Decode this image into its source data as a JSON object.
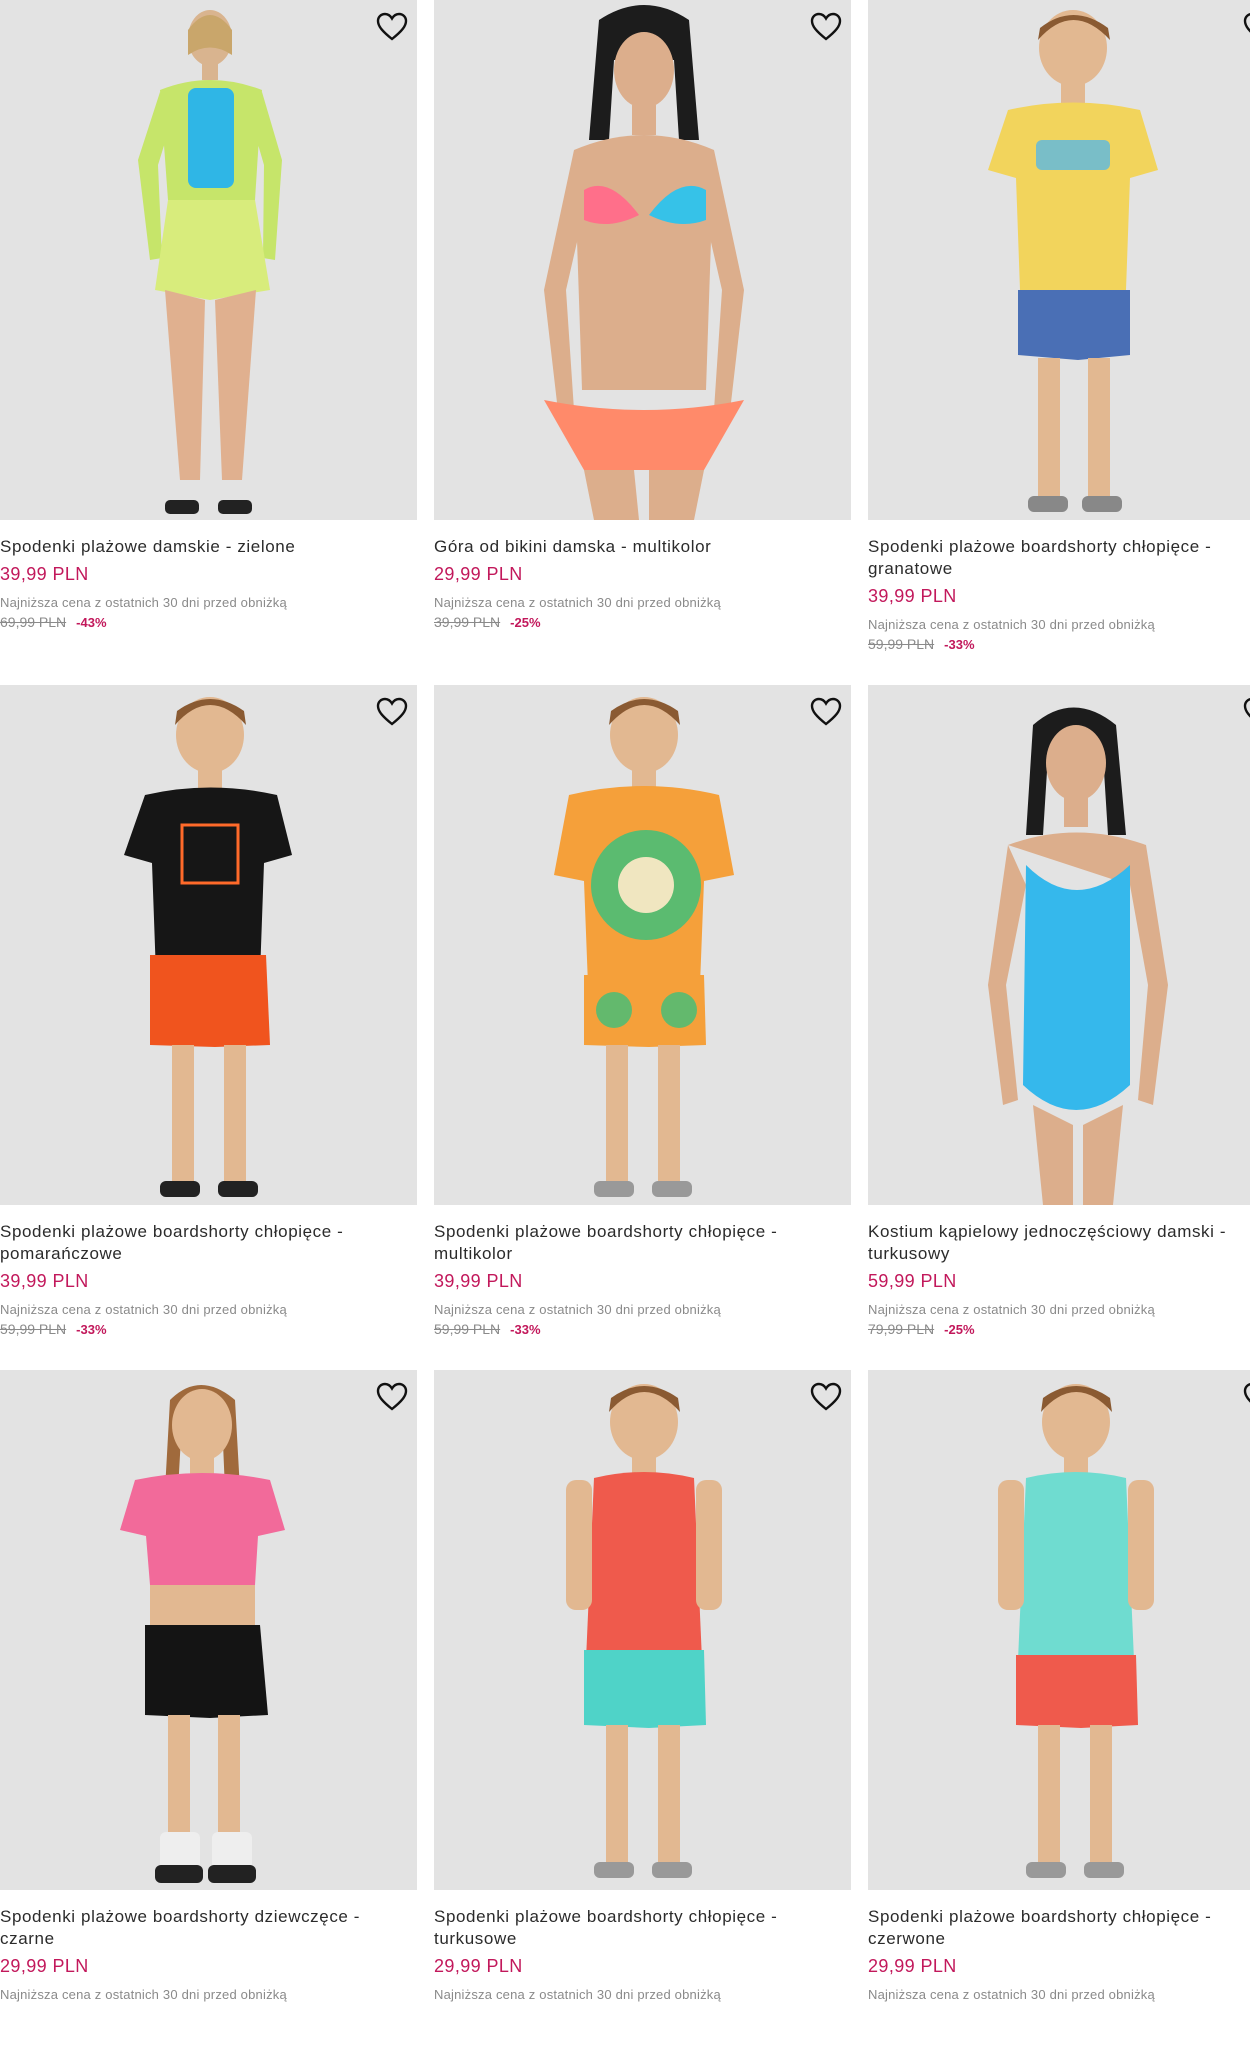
{
  "colors": {
    "price": "#c2185b",
    "muted": "#8a8a8a",
    "image_bg": "#e3e3e3"
  },
  "icons": {
    "wishlist": "heart-outline-icon"
  },
  "products": [
    {
      "name": "Spodenki plażowe damskie - zielone",
      "price": "39,99 PLN",
      "lowest_label": "Najniższa cena z ostatnich 30 dni przed obniżką",
      "old_price": "69,99 PLN",
      "discount": "-43%"
    },
    {
      "name": "Góra od bikini damska - multikolor",
      "price": "29,99 PLN",
      "lowest_label": "Najniższa cena z ostatnich 30 dni przed obniżką",
      "old_price": "39,99 PLN",
      "discount": "-25%"
    },
    {
      "name": "Spodenki plażowe boardshorty chłopięce - granatowe",
      "price": "39,99 PLN",
      "lowest_label": "Najniższa cena z ostatnich 30 dni przed obniżką",
      "old_price": "59,99 PLN",
      "discount": "-33%"
    },
    {
      "name": "Spodenki plażowe boardshorty chłopięce - pomarańczowe",
      "price": "39,99 PLN",
      "lowest_label": "Najniższa cena z ostatnich 30 dni przed obniżką",
      "old_price": "59,99 PLN",
      "discount": "-33%"
    },
    {
      "name": "Spodenki plażowe boardshorty chłopięce - multikolor",
      "price": "39,99 PLN",
      "lowest_label": "Najniższa cena z ostatnich 30 dni przed obniżką",
      "old_price": "59,99 PLN",
      "discount": "-33%"
    },
    {
      "name": "Kostium kąpielowy jednoczęściowy damski - turkusowy",
      "price": "59,99 PLN",
      "lowest_label": "Najniższa cena z ostatnich 30 dni przed obniżką",
      "old_price": "79,99 PLN",
      "discount": "-25%"
    },
    {
      "name": "Spodenki plażowe boardshorty dziewczęce - czarne",
      "price": "29,99 PLN",
      "lowest_label": "Najniższa cena z ostatnich 30 dni przed obniżką"
    },
    {
      "name": "Spodenki plażowe boardshorty chłopięce - turkusowe",
      "price": "29,99 PLN",
      "lowest_label": "Najniższa cena z ostatnich 30 dni przed obniżką"
    },
    {
      "name": "Spodenki plażowe boardshorty chłopięce - czerwone",
      "price": "29,99 PLN",
      "lowest_label": "Najniższa cena z ostatnich 30 dni przed obniżką"
    }
  ]
}
